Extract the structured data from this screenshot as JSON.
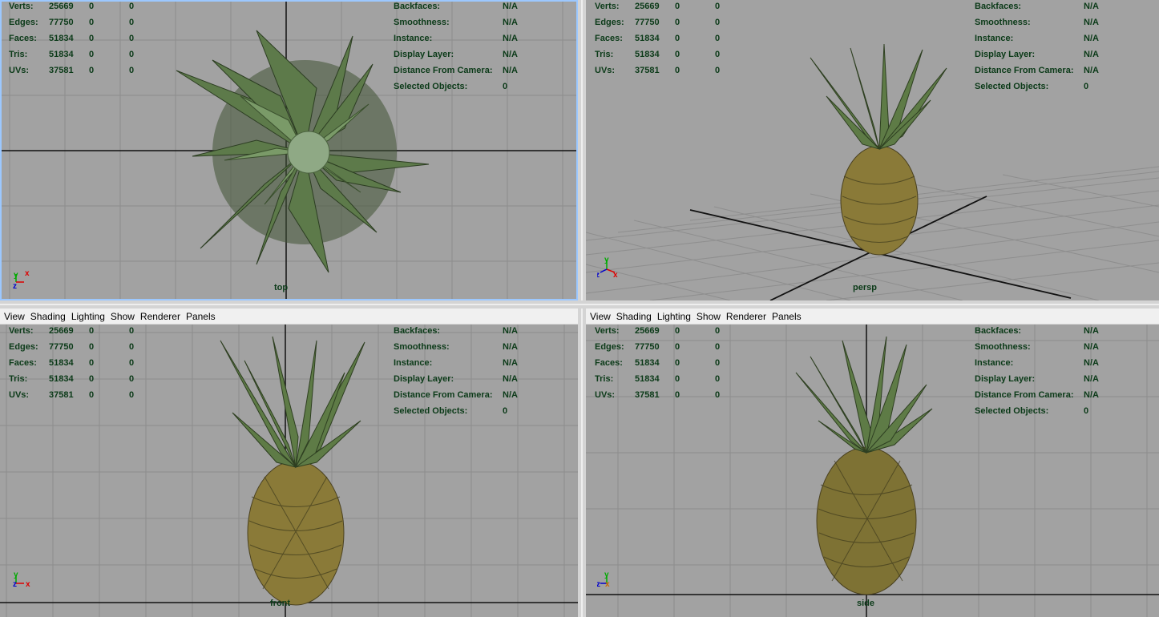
{
  "stats": [
    {
      "label": "Verts:",
      "v1": "25669",
      "v2": "0",
      "v3": "0"
    },
    {
      "label": "Edges:",
      "v1": "77750",
      "v2": "0",
      "v3": "0"
    },
    {
      "label": "Faces:",
      "v1": "51834",
      "v2": "0",
      "v3": "0"
    },
    {
      "label": "Tris:",
      "v1": "51834",
      "v2": "0",
      "v3": "0"
    },
    {
      "label": "UVs:",
      "v1": "37581",
      "v2": "0",
      "v3": "0"
    }
  ],
  "info": [
    {
      "label": "Backfaces:",
      "value": "N/A"
    },
    {
      "label": "Smoothness:",
      "value": "N/A"
    },
    {
      "label": "Instance:",
      "value": "N/A"
    },
    {
      "label": "Display Layer:",
      "value": "N/A"
    },
    {
      "label": "Distance From Camera:",
      "value": "N/A"
    },
    {
      "label": "Selected Objects:",
      "value": "0"
    }
  ],
  "menu": [
    "View",
    "Shading",
    "Lighting",
    "Show",
    "Renderer",
    "Panels"
  ],
  "viewports": {
    "top": {
      "camera": "top"
    },
    "persp": {
      "camera": "persp"
    },
    "front": {
      "camera": "front"
    },
    "side": {
      "camera": "side"
    }
  },
  "colors": {
    "viewport_bg": "#a2a2a2",
    "hud_text": "#0b3a18",
    "grid_line": "#8a8a8a",
    "axis_line": "#111111"
  }
}
